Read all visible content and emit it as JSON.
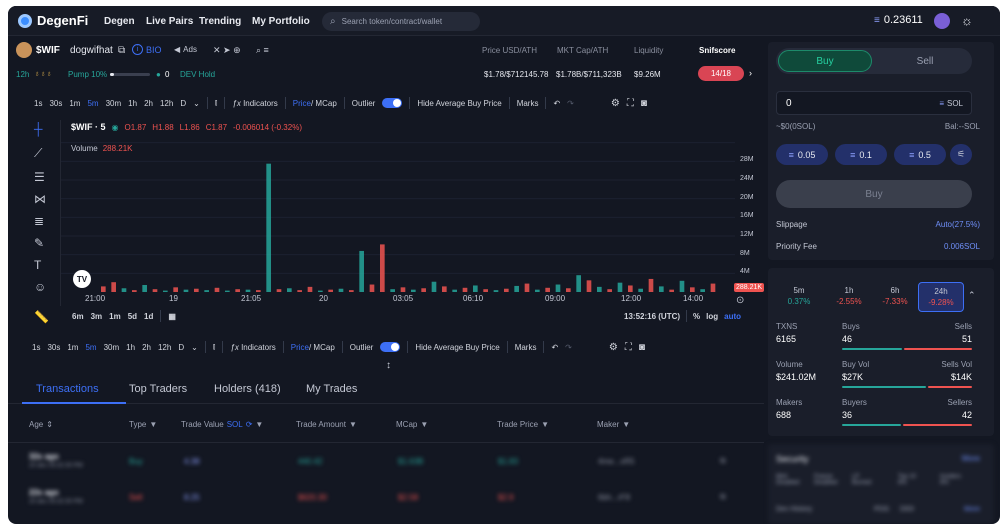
{
  "nav": {
    "brand": "DegenFi",
    "links": [
      "Degen",
      "Live Pairs",
      "Trending",
      "My Portfolio"
    ],
    "search_placeholder": "Search token/contract/wallet",
    "balance": "0.23611"
  },
  "token": {
    "symbol": "$WIF",
    "name": "dogwifhat",
    "bio": "BIO",
    "ads": "Ads",
    "age": "12h",
    "pump": "Pump 10%",
    "holders_count": "0",
    "dev": "DEV Hold",
    "stats_labels": [
      "Price USD/ATH",
      "MKT Cap/ATH",
      "Liquidity",
      "Snifscore"
    ],
    "stats_values": [
      "$1.78/$712145.78",
      "$1.78B/$711,323B",
      "$9.26M",
      "14/18"
    ]
  },
  "toolbar": {
    "timeframes": [
      "1s",
      "30s",
      "1m",
      "5m",
      "30m",
      "1h",
      "2h",
      "12h",
      "D"
    ],
    "active": "5m",
    "indicators": "Indicators",
    "price": "Price",
    "mcap": "/ MCap",
    "outlier": "Outlier",
    "hide_avg": "Hide Average Buy Price",
    "marks": "Marks"
  },
  "chart_data": {
    "type": "bar",
    "title": "$WIF · 5",
    "ohlc": {
      "o": "O1.87",
      "h": "H1.88",
      "l": "L1.86",
      "c": "C1.87",
      "chg": "-0.006014 (-0.32%)"
    },
    "volume_label": "Volume",
    "volume_value": "288.21K",
    "x_ticks": [
      "21:00",
      "19",
      "21:05",
      "20",
      "03:05",
      "06:10",
      "09:00",
      "12:00",
      "14:00"
    ],
    "y_ticks": [
      "28M",
      "24M",
      "20M",
      "16M",
      "12M",
      "8M",
      "4M"
    ],
    "last_tag": "288.21K",
    "ylim": [
      0,
      30
    ],
    "bars": [
      {
        "v": 1.2,
        "c": "r"
      },
      {
        "v": 2.1,
        "c": "r"
      },
      {
        "v": 0.8,
        "c": "g"
      },
      {
        "v": 0.4,
        "c": "r"
      },
      {
        "v": 1.5,
        "c": "g"
      },
      {
        "v": 0.6,
        "c": "r"
      },
      {
        "v": 0.3,
        "c": "g"
      },
      {
        "v": 1.0,
        "c": "r"
      },
      {
        "v": 0.5,
        "c": "g"
      },
      {
        "v": 0.7,
        "c": "r"
      },
      {
        "v": 0.4,
        "c": "g"
      },
      {
        "v": 0.9,
        "c": "r"
      },
      {
        "v": 0.3,
        "c": "g"
      },
      {
        "v": 0.6,
        "c": "r"
      },
      {
        "v": 0.5,
        "c": "g"
      },
      {
        "v": 0.4,
        "c": "r"
      },
      {
        "v": 27.5,
        "c": "g"
      },
      {
        "v": 0.6,
        "c": "r"
      },
      {
        "v": 0.8,
        "c": "g"
      },
      {
        "v": 0.4,
        "c": "r"
      },
      {
        "v": 1.1,
        "c": "r"
      },
      {
        "v": 0.3,
        "c": "g"
      },
      {
        "v": 0.5,
        "c": "r"
      },
      {
        "v": 0.7,
        "c": "g"
      },
      {
        "v": 0.4,
        "c": "r"
      },
      {
        "v": 8.8,
        "c": "g"
      },
      {
        "v": 1.6,
        "c": "r"
      },
      {
        "v": 10.2,
        "c": "r"
      },
      {
        "v": 0.6,
        "c": "g"
      },
      {
        "v": 1.0,
        "c": "r"
      },
      {
        "v": 0.5,
        "c": "g"
      },
      {
        "v": 0.8,
        "c": "r"
      },
      {
        "v": 2.2,
        "c": "g"
      },
      {
        "v": 1.2,
        "c": "r"
      },
      {
        "v": 0.5,
        "c": "g"
      },
      {
        "v": 0.9,
        "c": "r"
      },
      {
        "v": 1.4,
        "c": "g"
      },
      {
        "v": 0.6,
        "c": "r"
      },
      {
        "v": 0.4,
        "c": "g"
      },
      {
        "v": 0.7,
        "c": "r"
      },
      {
        "v": 1.3,
        "c": "g"
      },
      {
        "v": 1.8,
        "c": "r"
      },
      {
        "v": 0.5,
        "c": "g"
      },
      {
        "v": 0.9,
        "c": "r"
      },
      {
        "v": 1.6,
        "c": "g"
      },
      {
        "v": 0.8,
        "c": "r"
      },
      {
        "v": 3.6,
        "c": "g"
      },
      {
        "v": 2.5,
        "c": "r"
      },
      {
        "v": 1.1,
        "c": "g"
      },
      {
        "v": 0.6,
        "c": "r"
      },
      {
        "v": 2.0,
        "c": "g"
      },
      {
        "v": 1.4,
        "c": "r"
      },
      {
        "v": 0.7,
        "c": "g"
      },
      {
        "v": 2.8,
        "c": "r"
      },
      {
        "v": 1.2,
        "c": "g"
      },
      {
        "v": 0.5,
        "c": "r"
      },
      {
        "v": 2.4,
        "c": "g"
      },
      {
        "v": 1.0,
        "c": "r"
      },
      {
        "v": 0.6,
        "c": "g"
      },
      {
        "v": 1.8,
        "c": "r"
      }
    ]
  },
  "bottombar": {
    "ranges": [
      "6m",
      "3m",
      "1m",
      "5d",
      "1d"
    ],
    "time": "13:52:16 (UTC)",
    "pct": "%",
    "log": "log",
    "auto": "auto"
  },
  "tabs": [
    "Transactions",
    "Top Traders",
    "Holders (418)",
    "My Trades"
  ],
  "table": {
    "headers": [
      "Age",
      "Type",
      "Trade Value",
      "SOL",
      "Trade Amount",
      "MCap",
      "Trade Price",
      "Maker"
    ],
    "rows": [
      {
        "age": "32s ago",
        "date": "20 dec 05:32:30 PM",
        "type": "Buy",
        "value": "4.38",
        "amount": "440.42",
        "mcap": "$1.63B",
        "price": "$1.83",
        "maker": "4me...xR5"
      },
      {
        "age": "22s ago",
        "date": "20 dec 05:32:30 PM",
        "type": "Sell",
        "value": "8.25",
        "amount": "$620.30",
        "mcap": "$2.58",
        "price": "$2.9",
        "maker": "6bh...rF8"
      }
    ]
  },
  "trade": {
    "buy": "Buy",
    "sell": "Sell",
    "amount": "0",
    "unit": "SOL",
    "usd": "~$0(0SOL)",
    "bal": "Bal:--SOL",
    "quick": [
      "0.05",
      "0.1",
      "0.5"
    ],
    "buy_button": "Buy",
    "slippage_label": "Slippage",
    "slippage_value": "Auto(27.5%)",
    "priority_label": "Priority Fee",
    "priority_value": "0.006SOL"
  },
  "periods": [
    {
      "label": "5m",
      "chg": "0.37%",
      "up": true
    },
    {
      "label": "1h",
      "chg": "-2.55%",
      "up": false
    },
    {
      "label": "6h",
      "chg": "-7.33%",
      "up": false
    },
    {
      "label": "24h",
      "chg": "-9.28%",
      "up": false
    }
  ],
  "stats": [
    {
      "a_label": "TXNS",
      "a_val": "6165",
      "b_label": "Buys",
      "b_val": "46",
      "c_label": "Sells",
      "c_val": "51",
      "split": 0.47
    },
    {
      "a_label": "Volume",
      "a_val": "$241.02M",
      "b_label": "Buy Vol",
      "b_val": "$27K",
      "c_label": "Sells Vol",
      "c_val": "$14K",
      "split": 0.66
    },
    {
      "a_label": "Makers",
      "a_val": "688",
      "b_label": "Buyers",
      "b_val": "36",
      "c_label": "Sellers",
      "c_val": "42",
      "split": 0.46
    }
  ],
  "security": {
    "title": "Security",
    "more": "More",
    "items": [
      "Mint Disabled",
      "Freeze Disabled",
      "LP Burned",
      "Top 10 8%",
      "Insiders 8%"
    ],
    "dev_history": "Dev History",
    "tags": [
      "PDG",
      "DIDI"
    ]
  },
  "colors": {
    "up": "#26a69a",
    "down": "#ef5350",
    "accent": "#3d6ff5"
  }
}
